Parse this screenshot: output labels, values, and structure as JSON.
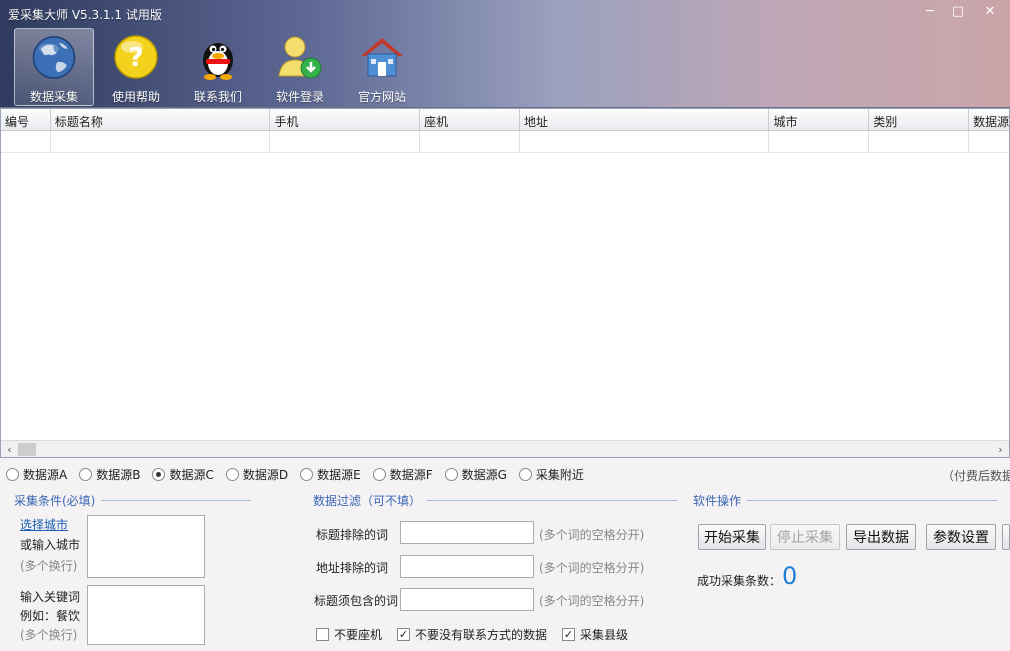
{
  "window": {
    "title": "爱采集大师 V5.3.1.1 试用版",
    "minimize_glyph": "─",
    "maximize_glyph": "□",
    "close_glyph": "✕"
  },
  "toolbar": {
    "items": [
      {
        "label": "数据采集",
        "icon": "globe-icon",
        "active": true
      },
      {
        "label": "使用帮助",
        "icon": "help-icon",
        "active": false
      },
      {
        "label": "联系我们",
        "icon": "qq-penguin-icon",
        "active": false
      },
      {
        "label": "软件登录",
        "icon": "user-login-icon",
        "active": false
      },
      {
        "label": "官方网站",
        "icon": "home-icon",
        "active": false
      }
    ]
  },
  "table": {
    "columns": [
      "编号",
      "标题名称",
      "手机",
      "座机",
      "地址",
      "城市",
      "类别",
      "数据源"
    ],
    "rows": []
  },
  "sources": {
    "options": [
      "数据源A",
      "数据源B",
      "数据源C",
      "数据源D",
      "数据源E",
      "数据源F",
      "数据源G",
      "采集附近"
    ],
    "selected": "数据源C",
    "paid_note": "（付费后数据"
  },
  "collect": {
    "title": "采集条件(必填)",
    "select_city_link": "选择城市",
    "or_input_city": "或输入城市",
    "multi_line_hint": "(多个换行)",
    "keyword_label": "输入关键词",
    "keyword_example": "例如：餐饮",
    "keyword_hint": "(多个换行)"
  },
  "filter": {
    "title": "数据过滤（可不填）",
    "title_exclude_label": "标题排除的词",
    "address_exclude_label": "地址排除的词",
    "title_include_label": "标题须包含的词",
    "space_hint": "(多个词的空格分开)",
    "no_landline": {
      "label": "不要座机",
      "checked": false
    },
    "no_contact": {
      "label": "不要没有联系方式的数据",
      "checked": true
    },
    "county_level": {
      "label": "采集县级",
      "checked": true
    }
  },
  "ops": {
    "title": "软件操作",
    "start": "开始采集",
    "stop": "停止采集",
    "export": "导出数据",
    "settings": "参数设置",
    "success_label": "成功采集条数：",
    "success_count": "0"
  },
  "colors": {
    "accent": "#3a66b5",
    "count": "#1e7fd6"
  }
}
